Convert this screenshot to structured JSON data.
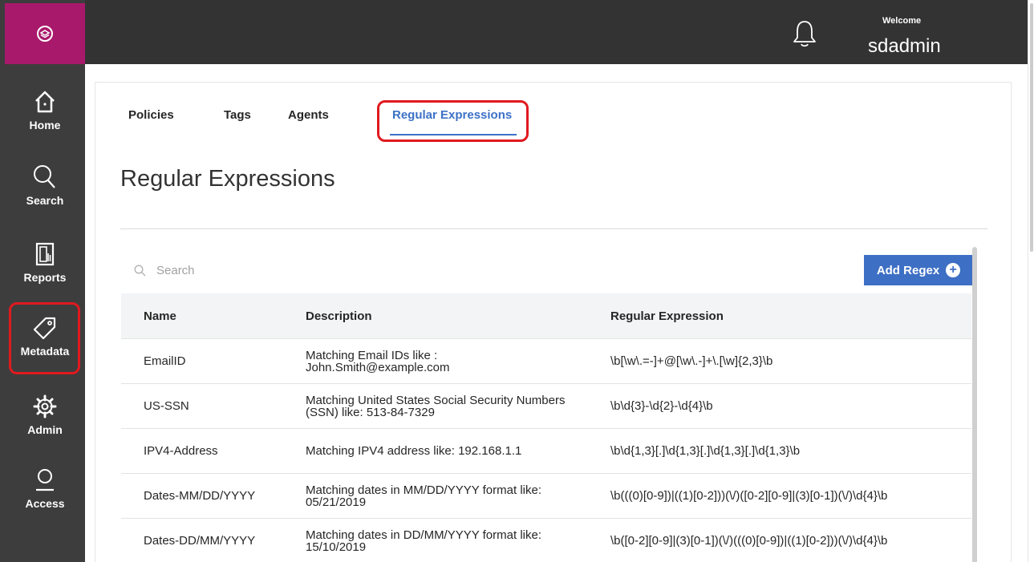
{
  "topbar": {
    "welcome": "Welcome",
    "username": "sdadmin"
  },
  "sidebar": {
    "logo_icon": "logo-icon",
    "items": [
      {
        "label": "Home",
        "icon": "home-icon"
      },
      {
        "label": "Search",
        "icon": "search-icon"
      },
      {
        "label": "Reports",
        "icon": "reports-icon"
      },
      {
        "label": "Metadata",
        "icon": "tag-icon"
      },
      {
        "label": "Admin",
        "icon": "gear-icon"
      },
      {
        "label": "Access",
        "icon": "user-icon"
      }
    ]
  },
  "tabs": [
    {
      "label": "Policies"
    },
    {
      "label": "Tags"
    },
    {
      "label": "Agents"
    },
    {
      "label": "Regular Expressions",
      "active": true
    }
  ],
  "page": {
    "title": "Regular Expressions"
  },
  "search": {
    "placeholder": "Search"
  },
  "add_button": {
    "label": "Add Regex"
  },
  "table": {
    "headers": [
      "Name",
      "Description",
      "Regular Expression"
    ],
    "rows": [
      {
        "name": "EmailID",
        "description": "Matching Email IDs like :\nJohn.Smith@example.com",
        "regex": "\\b[\\w\\.=-]+@[\\w\\.-]+\\.[\\w]{2,3}\\b"
      },
      {
        "name": "US-SSN",
        "description": "Matching United States Social Security Numbers\n(SSN) like: 513-84-7329",
        "regex": "\\b\\d{3}-\\d{2}-\\d{4}\\b"
      },
      {
        "name": "IPV4-Address",
        "description": "Matching IPV4 address like: 192.168.1.1",
        "regex": "\\b\\d{1,3}[.]\\d{1,3}[.]\\d{1,3}[.]\\d{1,3}\\b"
      },
      {
        "name": "Dates-MM/DD/YYYY",
        "description": "Matching dates in MM/DD/YYYY format like:\n05/21/2019",
        "regex": "\\b(((0)[0-9])|((1)[0-2]))(\\/)([0-2][0-9]|(3)[0-1])(\\/)\\d{4}\\b"
      },
      {
        "name": "Dates-DD/MM/YYYY",
        "description": "Matching dates in DD/MM/YYYY format like:\n15/10/2019",
        "regex": "\\b([0-2][0-9]|(3)[0-1])(\\/)(((0)[0-9])|((1)[0-2]))(\\/)\\d{4}\\b"
      }
    ]
  },
  "colors": {
    "sidebar": "#3d3d3d",
    "logo_bg": "#a8196b",
    "topbar": "#333333",
    "accent": "#3d71c7",
    "highlight": "#e0191f"
  }
}
